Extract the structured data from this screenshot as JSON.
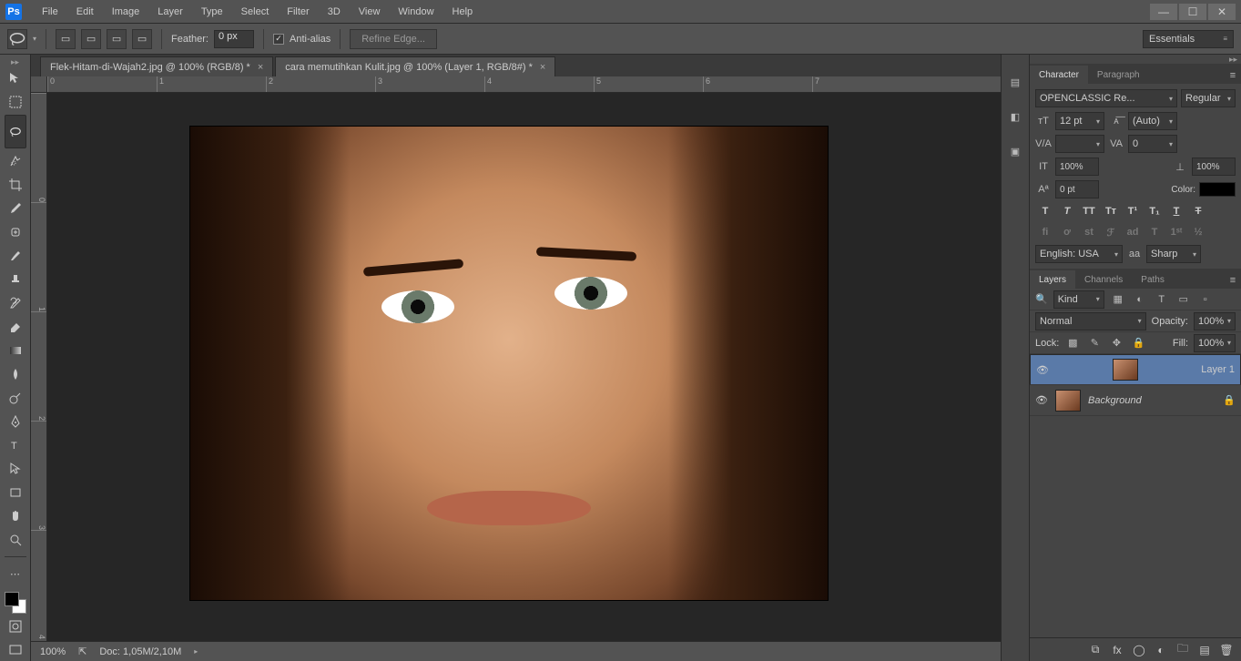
{
  "menubar": {
    "logo": "Ps",
    "items": [
      "File",
      "Edit",
      "Image",
      "Layer",
      "Type",
      "Select",
      "Filter",
      "3D",
      "View",
      "Window",
      "Help"
    ]
  },
  "optionsbar": {
    "feather_label": "Feather:",
    "feather_value": "0 px",
    "antialias_label": "Anti-alias",
    "refine_label": "Refine Edge...",
    "workspace": "Essentials"
  },
  "tabs": [
    {
      "title": "Flek-Hitam-di-Wajah2.jpg @ 100% (RGB/8) *",
      "active": false
    },
    {
      "title": "cara memutihkan Kulit.jpg @ 100% (Layer 1, RGB/8#) *",
      "active": true
    }
  ],
  "ruler_h": [
    "0",
    "1",
    "2",
    "3",
    "4",
    "5",
    "6",
    "7"
  ],
  "ruler_v": [
    "0",
    "1",
    "2",
    "3",
    "4"
  ],
  "status": {
    "zoom": "100%",
    "doc": "Doc: 1,05M/2,10M"
  },
  "character": {
    "tab1": "Character",
    "tab2": "Paragraph",
    "font": "OPENCLASSIC Re...",
    "style": "Regular",
    "size": "12 pt",
    "leading": "(Auto)",
    "tracking": "0",
    "scaleV": "100%",
    "scaleH": "100%",
    "baseline": "0 pt",
    "color_label": "Color:",
    "lang": "English: USA",
    "aa_label": "aa",
    "aa": "Sharp"
  },
  "layers_panel": {
    "tab1": "Layers",
    "tab2": "Channels",
    "tab3": "Paths",
    "filter": "Kind",
    "blend": "Normal",
    "opacity_label": "Opacity:",
    "opacity": "100%",
    "lock_label": "Lock:",
    "fill_label": "Fill:",
    "fill": "100%",
    "layers": [
      {
        "name": "Layer 1",
        "selected": true,
        "bg": false
      },
      {
        "name": "Background",
        "selected": false,
        "bg": true
      }
    ]
  }
}
